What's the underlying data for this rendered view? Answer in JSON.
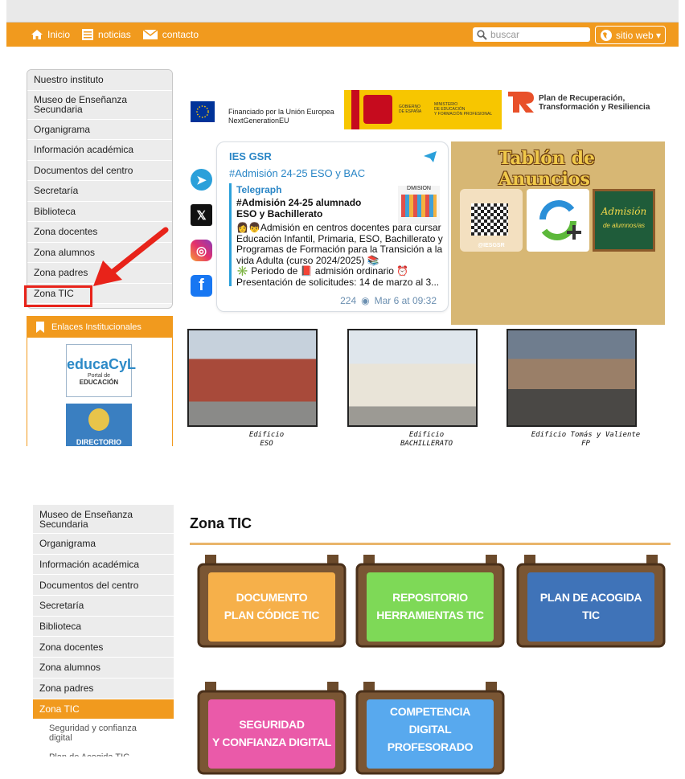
{
  "nav": {
    "inicio": "Inicio",
    "noticias": "noticias",
    "contacto": "contacto",
    "search_placeholder": "buscar",
    "sitio_web": "sitio web ▾"
  },
  "menu_top": [
    "Nuestro instituto",
    "Museo de Enseñanza Secundaria",
    "Organigrama",
    "Información académica",
    "Documentos del centro",
    "Secretaría",
    "Biblioteca",
    "Zona docentes",
    "Zona alumnos",
    "Zona padres",
    "Zona TIC"
  ],
  "enlaces": {
    "title": "Enlaces Institucionales",
    "educa_main": "educaCyL",
    "educa_sub1": "Portal de",
    "educa_sub2": "EDUCACIÓN",
    "directorio": "DIRECTORIO"
  },
  "funding": {
    "eu_line1": "Financiado por la Unión Europea",
    "eu_line2": "NextGenerationEU",
    "gob_line1": "GOBIERNO",
    "gob_line2": "DE ESPAÑA",
    "min_line1": "MINISTERIO",
    "min_line2": "DE EDUCACIÓN",
    "min_line3": "Y FORMACIÓN PROFESIONAL",
    "prtr_line1": "Plan de Recuperación,",
    "prtr_line2": "Transformación y Resiliencia"
  },
  "telegram": {
    "channel": "IES GSR",
    "headline": "#Admisión 24-25 ESO y BAC",
    "source": "Telegraph",
    "title": "#Admisión 24-25 alumnado ESO y Bachillerato",
    "thumb_label": "DMISIÓN",
    "body1": "👩👦Admisión en centros docentes para cursar Educación Infantil, Primaria, ESO, Bachillerato y Programas de Formación para la Transición a la vida Adulta (curso 2024/2025) 📚",
    "body2": "✳️ Periodo de 📕 admisión ordinario ⏰",
    "body3": "Presentación de solicitudes: 14 de marzo al 3...",
    "views": "224",
    "date": "Mar 6 at 09:32"
  },
  "tablon": {
    "title": "Tablón de Anuncios",
    "qr_label": "@IESGSR",
    "admision_1": "Admisión",
    "admision_2": "de alumnos/as"
  },
  "buildings": [
    {
      "caption1": "Edificio",
      "caption2": "ESO"
    },
    {
      "caption1": "Edificio",
      "caption2": "BACHILLERATO"
    },
    {
      "caption1": "Edificio Tomás y Valiente",
      "caption2": "FP"
    }
  ],
  "menu_bottom": [
    "Museo de Enseñanza Secundaria",
    "Organigrama",
    "Información académica",
    "Documentos del centro",
    "Secretaría",
    "Biblioteca",
    "Zona docentes",
    "Zona alumnos",
    "Zona padres",
    "Zona TIC"
  ],
  "submenu": [
    "Seguridad y confianza digital",
    "Plan de Acogida TIC"
  ],
  "zona_tic": {
    "title": "Zona TIC",
    "cards": [
      {
        "line1": "DOCUMENTO",
        "line2": "PLAN CÓDICE TIC",
        "line3": "",
        "color": "#f6b04a"
      },
      {
        "line1": "REPOSITORIO",
        "line2": "HERRAMIENTAS TIC",
        "line3": "",
        "color": "#7ed957"
      },
      {
        "line1": "PLAN DE ACOGIDA",
        "line2": "TIC",
        "line3": "",
        "color": "#3f73b8"
      },
      {
        "line1": "SEGURIDAD",
        "line2": "Y CONFIANZA DIGITAL",
        "line3": "",
        "color": "#ea5aa9"
      },
      {
        "line1": "COMPETENCIA",
        "line2": "DIGITAL",
        "line3": "PROFESORADO",
        "color": "#58a9ee"
      }
    ]
  },
  "colors": {
    "accent": "#f19a1e",
    "highlight": "#e8231a"
  }
}
